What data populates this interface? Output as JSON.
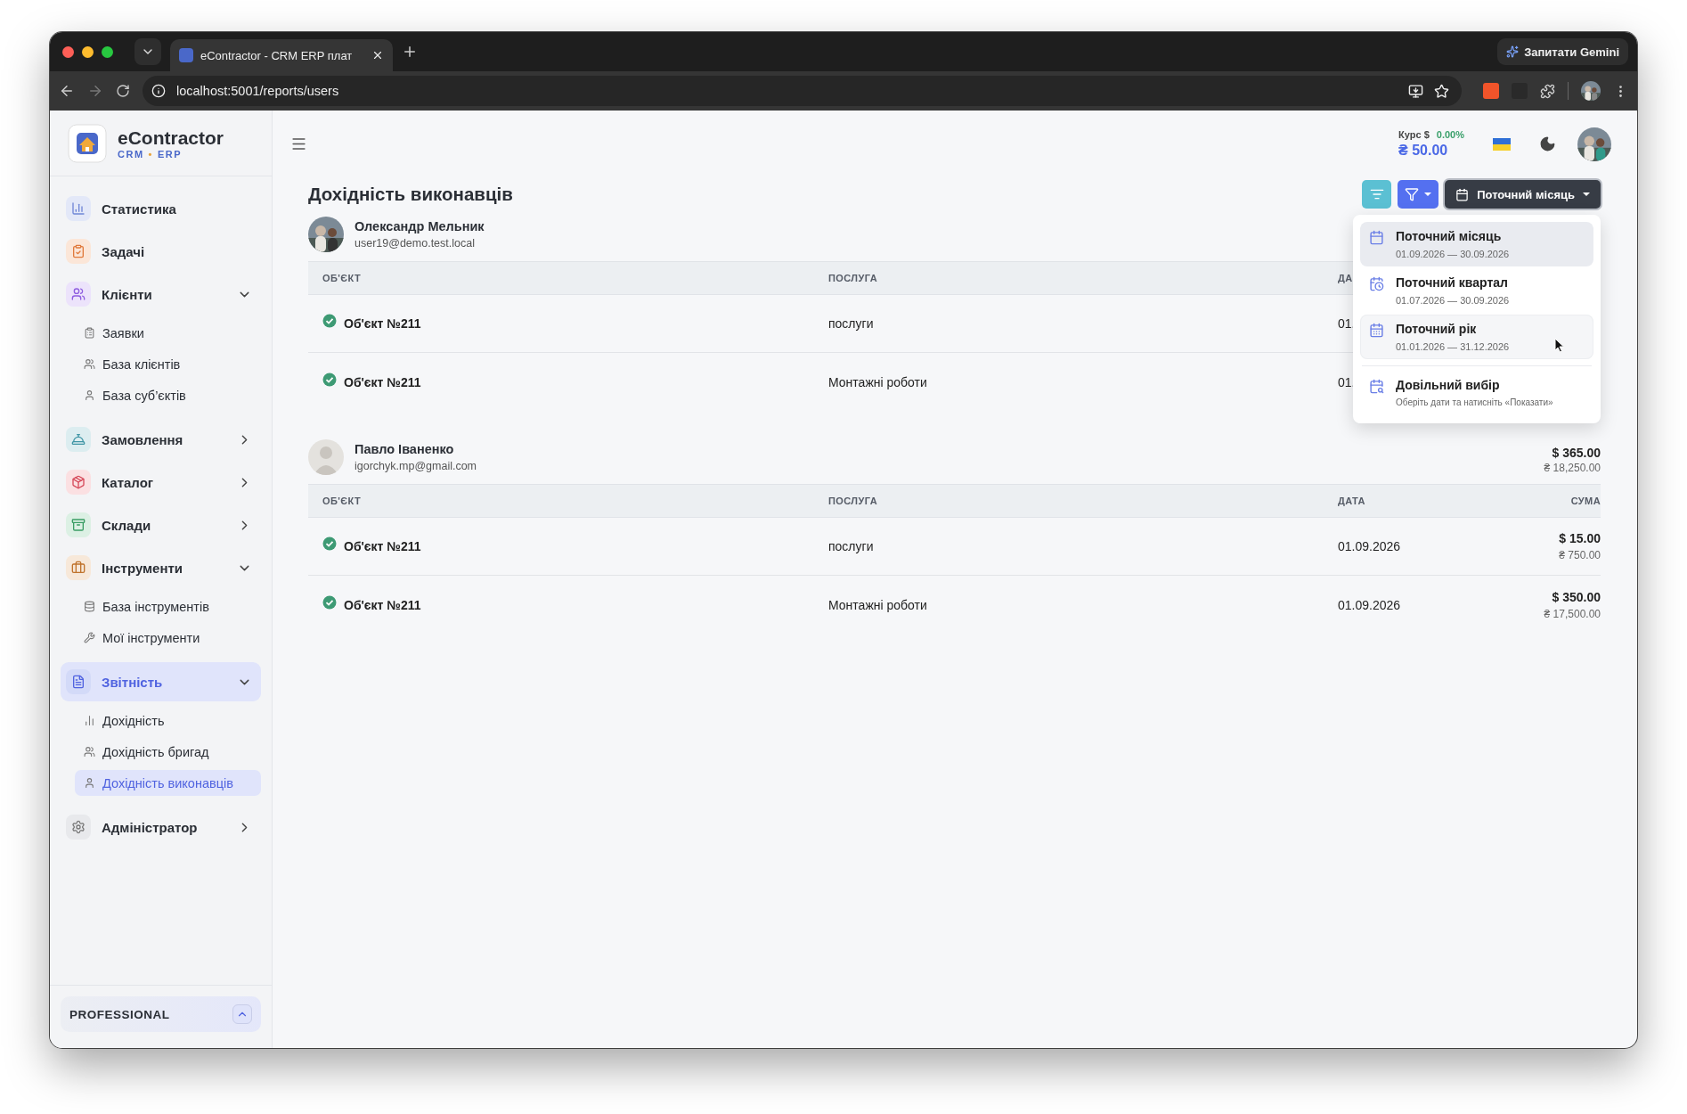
{
  "browser": {
    "tab": {
      "title": "eContractor - CRM ERP плат"
    },
    "url": "localhost:5001/reports/users",
    "gemini": "Запитати Gemini",
    "forward_disabled": true
  },
  "brand": {
    "name": "eContractor",
    "tag_1": "CRM",
    "separator": "•",
    "tag_2": "ERP"
  },
  "sidebar": {
    "items": [
      {
        "label": "Статистика",
        "selected": false
      },
      {
        "label": "Задачі",
        "selected": false
      },
      {
        "label": "Клієнти",
        "selected": false,
        "expanded": true,
        "children": [
          {
            "label": "Заявки",
            "selected": false
          },
          {
            "label": "База клієнтів",
            "selected": false
          },
          {
            "label": "База суб’єктів",
            "selected": false
          }
        ]
      },
      {
        "label": "Замовлення",
        "selected": false,
        "expanded": false
      },
      {
        "label": "Каталог",
        "selected": false,
        "expanded": false
      },
      {
        "label": "Склади",
        "selected": false,
        "expanded": false
      },
      {
        "label": "Інструменти",
        "selected": false,
        "expanded": true,
        "children": [
          {
            "label": "База інструментів",
            "selected": false
          },
          {
            "label": "Мої інструменти",
            "selected": false
          }
        ]
      },
      {
        "label": "Звітність",
        "selected": true,
        "expanded": true,
        "children": [
          {
            "label": "Дохідність",
            "selected": false
          },
          {
            "label": "Дохідність бригад",
            "selected": false
          },
          {
            "label": "Дохідність виконавців",
            "selected": true
          }
        ]
      },
      {
        "label": "Адміністратор",
        "selected": false,
        "expanded": false
      }
    ],
    "plan": {
      "label": "PROFESSIONAL"
    }
  },
  "header": {
    "rate": {
      "label": "Курс $",
      "change": "0.00%",
      "value": "₴ 50.00"
    }
  },
  "report": {
    "title": "Дохідність виконавців",
    "period_button": "Поточний місяць",
    "menu": {
      "items": [
        {
          "kind": "preset",
          "title": "Поточний місяць",
          "subtitle": "01.09.2026 — 30.09.2026",
          "selected": true,
          "hovered": false
        },
        {
          "kind": "preset",
          "title": "Поточний квартал",
          "subtitle": "01.07.2026 — 30.09.2026",
          "selected": false,
          "hovered": false
        },
        {
          "kind": "preset",
          "title": "Поточний рік",
          "subtitle": "01.01.2026 — 31.12.2026",
          "selected": false,
          "hovered": true
        },
        {
          "kind": "custom",
          "title": "Довільний вибір",
          "subtitle": "Оберіть дати та натисніть «Показати»",
          "selected": false,
          "hovered": false
        }
      ]
    },
    "groups": [
      {
        "name": "Олександр Мельник",
        "email": "user19@demo.test.local",
        "has_photo": true,
        "columns": [
          "ОБ'ЄКТ",
          "ПОСЛУГА",
          "ДА"
        ],
        "rows": [
          {
            "object": "Об'єкт №211",
            "service": "послуги",
            "date": "01.",
            "completed": true
          },
          {
            "object": "Об'єкт №211",
            "service": "Монтажні роботи",
            "date": "01.",
            "completed": true
          }
        ]
      },
      {
        "name": "Павло Іваненко",
        "email": "igorchyk.mp@gmail.com",
        "has_photo": false,
        "total_usd": "$ 365.00",
        "total_uah": "₴ 18,250.00",
        "columns": [
          "ОБ'ЄКТ",
          "ПОСЛУГА",
          "ДАТА",
          "СУМА"
        ],
        "rows": [
          {
            "object": "Об'єкт №211",
            "service": "послуги",
            "date": "01.09.2026",
            "sum_usd": "$ 15.00",
            "sum_uah": "₴ 750.00",
            "completed": true
          },
          {
            "object": "Об'єкт №211",
            "service": "Монтажні роботи",
            "date": "01.09.2026",
            "sum_usd": "$ 350.00",
            "sum_uah": "₴ 17,500.00",
            "completed": true
          }
        ]
      }
    ]
  }
}
